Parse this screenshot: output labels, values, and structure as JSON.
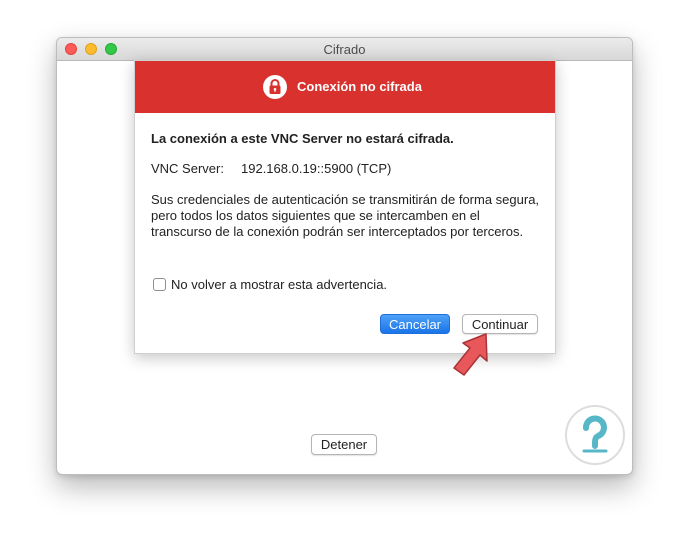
{
  "window": {
    "title": "Cifrado",
    "stop_button_label": "Detener"
  },
  "dialog": {
    "title": "Conexión no cifrada",
    "heading": "La conexión a este VNC Server no estará cifrada.",
    "server_label": "VNC Server:",
    "server_value": "192.168.0.19::5900 (TCP)",
    "message": "Sus credenciales de autenticación se transmitirán de forma segura, pero todos los datos siguientes que se intercamben en el transcurso de la conexión podrán ser interceptados por terceros.",
    "checkbox_label": "No volver a mostrar esta advertencia.",
    "checkbox_checked": false,
    "cancel_label": "Cancelar",
    "continue_label": "Continuar",
    "icon": "lock-icon"
  },
  "colors": {
    "header_red": "#d9312e",
    "primary_blue": "#1a74e8",
    "pointer_arrow": "#e8575a",
    "watermark_teal": "#57b7c6"
  }
}
